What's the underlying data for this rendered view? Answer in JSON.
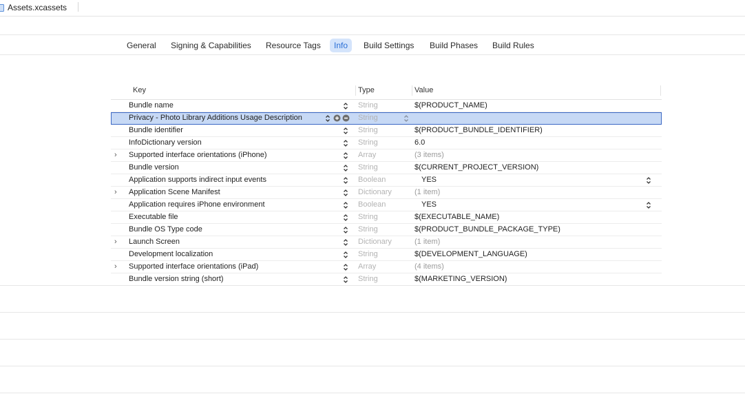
{
  "file_tab": {
    "name": "Assets.xcassets"
  },
  "editor_tabs": [
    {
      "label": "General"
    },
    {
      "label": "Signing & Capabilities"
    },
    {
      "label": "Resource Tags"
    },
    {
      "label": "Info",
      "active": true
    },
    {
      "label": "Build Settings"
    },
    {
      "label": "Build Phases"
    },
    {
      "label": "Build Rules"
    }
  ],
  "table": {
    "headers": {
      "key": "Key",
      "type": "Type",
      "value": "Value"
    },
    "rows": [
      {
        "key": "Bundle name",
        "type": "String",
        "value": "$(PRODUCT_NAME)"
      },
      {
        "key": "Privacy - Photo Library Additions Usage Description",
        "type": "String",
        "value": "",
        "selected": true
      },
      {
        "key": "Bundle identifier",
        "type": "String",
        "value": "$(PRODUCT_BUNDLE_IDENTIFIER)"
      },
      {
        "key": "InfoDictionary version",
        "type": "String",
        "value": "6.0"
      },
      {
        "key": "Supported interface orientations (iPhone)",
        "type": "Array",
        "value": "(3 items)",
        "expandable": true
      },
      {
        "key": "Bundle version",
        "type": "String",
        "value": "$(CURRENT_PROJECT_VERSION)"
      },
      {
        "key": "Application supports indirect input events",
        "type": "Boolean",
        "value": "YES",
        "popup": true
      },
      {
        "key": "Application Scene Manifest",
        "type": "Dictionary",
        "value": "(1 item)",
        "expandable": true
      },
      {
        "key": "Application requires iPhone environment",
        "type": "Boolean",
        "value": "YES",
        "popup": true
      },
      {
        "key": "Executable file",
        "type": "String",
        "value": "$(EXECUTABLE_NAME)"
      },
      {
        "key": "Bundle OS Type code",
        "type": "String",
        "value": "$(PRODUCT_BUNDLE_PACKAGE_TYPE)"
      },
      {
        "key": "Launch Screen",
        "type": "Dictionary",
        "value": "(1 item)",
        "expandable": true
      },
      {
        "key": "Development localization",
        "type": "String",
        "value": "$(DEVELOPMENT_LANGUAGE)"
      },
      {
        "key": "Supported interface orientations (iPad)",
        "type": "Array",
        "value": "(4 items)",
        "expandable": true
      },
      {
        "key": "Bundle version string (short)",
        "type": "String",
        "value": "$(MARKETING_VERSION)"
      }
    ]
  },
  "icons": {
    "file": "asset-catalog-icon",
    "disclosure": "chevron-right-icon",
    "stepper": "up-down-chevron-icon",
    "add": "plus-circle-icon",
    "remove": "minus-circle-icon"
  },
  "colors": {
    "selection_fill": "#c7d9f5",
    "selection_border": "#3b67c4",
    "active_tab_bg": "#d4e4fb",
    "active_tab_text": "#2a6fd6"
  }
}
